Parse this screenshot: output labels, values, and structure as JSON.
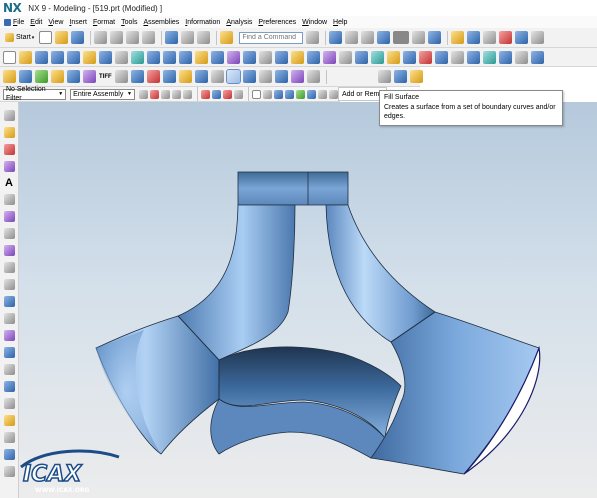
{
  "window": {
    "logo": "NX",
    "title": "NX 9 - Modeling - [519.prt (Modified) ]"
  },
  "menu": [
    {
      "label": "File"
    },
    {
      "label": "Edit"
    },
    {
      "label": "View"
    },
    {
      "label": "Insert"
    },
    {
      "label": "Format"
    },
    {
      "label": "Tools"
    },
    {
      "label": "Assemblies"
    },
    {
      "label": "Information"
    },
    {
      "label": "Analysis"
    },
    {
      "label": "Preferences"
    },
    {
      "label": "Window"
    },
    {
      "label": "Help"
    }
  ],
  "toolbar": {
    "start_label": "Start",
    "find_command_placeholder": "Find a Command",
    "tiff_label": "TIFF"
  },
  "selection": {
    "filter_value": "No Selection Filter",
    "scope_value": "Entire Assembly",
    "add_remove_label": "Add or Remo"
  },
  "tooltip": {
    "title": "Fill Surface",
    "description": "Creates a surface from a set of boundary curves and/or edges."
  },
  "left_toolbar": {
    "text_tool_label": "A"
  },
  "watermark": {
    "text": "ICAX",
    "url": "WWW.ICAX.ORG"
  },
  "colors": {
    "model_light": "#9cc0ec",
    "model_dark": "#24415f",
    "model_edge": "#1b2a3c",
    "background_top": "#b5c9dc",
    "background_bottom": "#ececec"
  }
}
